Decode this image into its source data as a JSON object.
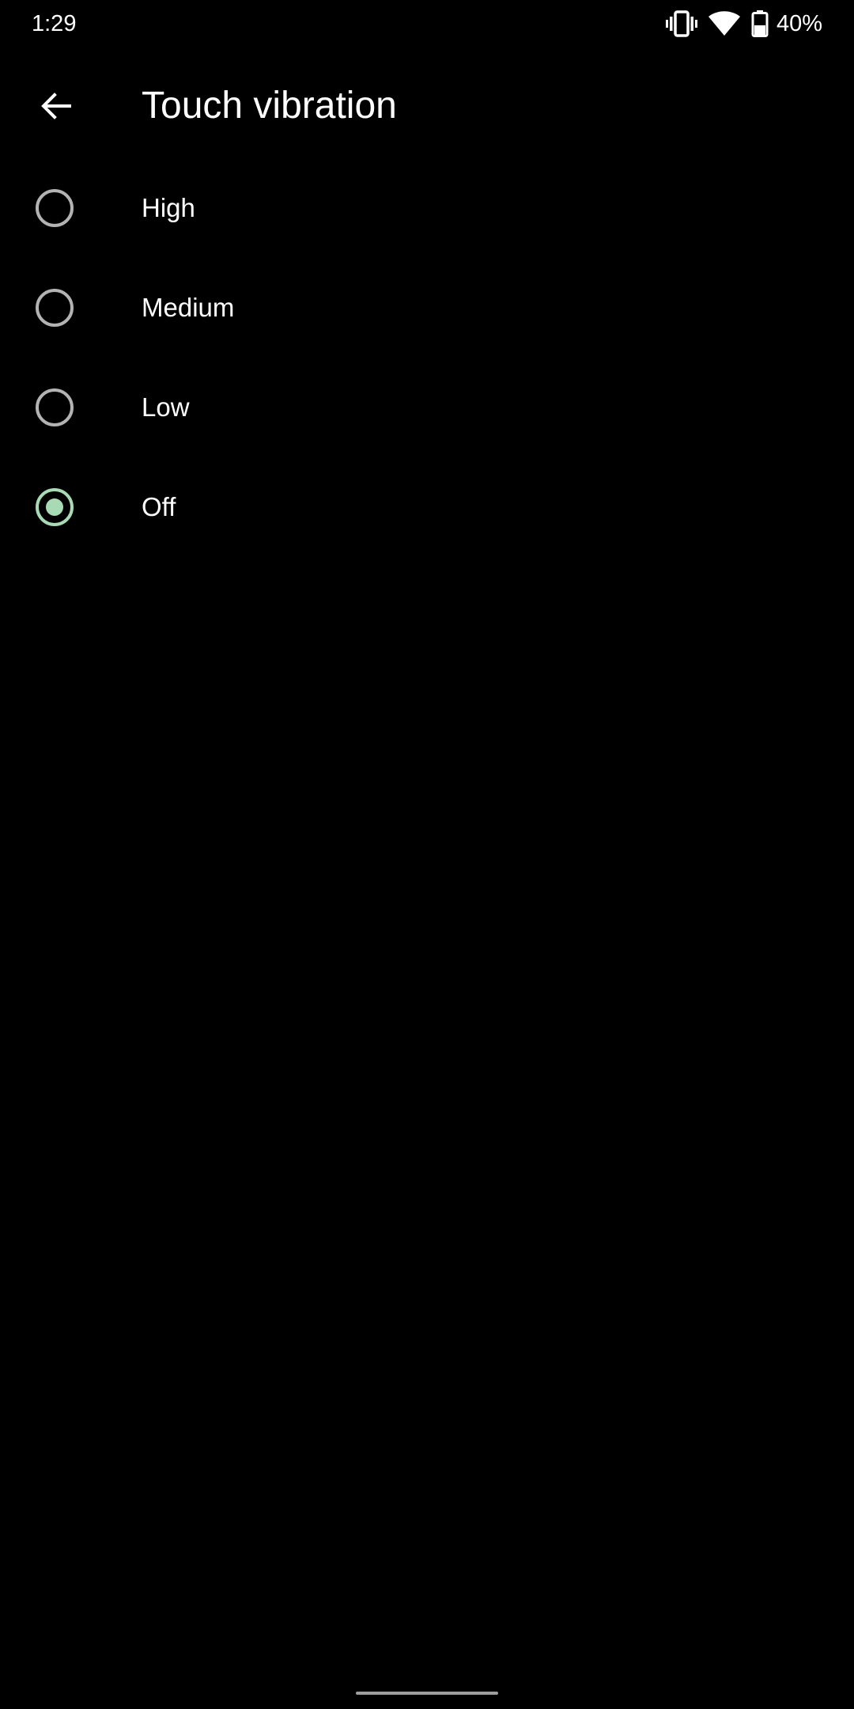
{
  "status_bar": {
    "time": "1:29",
    "battery_percent": "40%",
    "icons": [
      "vibrate-icon",
      "wifi-icon",
      "battery-icon"
    ]
  },
  "app_bar": {
    "title": "Touch vibration",
    "back_icon": "arrow-back-icon"
  },
  "options": [
    {
      "label": "High",
      "selected": false
    },
    {
      "label": "Medium",
      "selected": false
    },
    {
      "label": "Low",
      "selected": false
    },
    {
      "label": "Off",
      "selected": true
    }
  ],
  "colors": {
    "background": "#000000",
    "text": "#ffffff",
    "radio_unchecked": "#b3b3b3",
    "radio_checked": "#a8dab5",
    "nav_handle": "#9e9e9e"
  }
}
